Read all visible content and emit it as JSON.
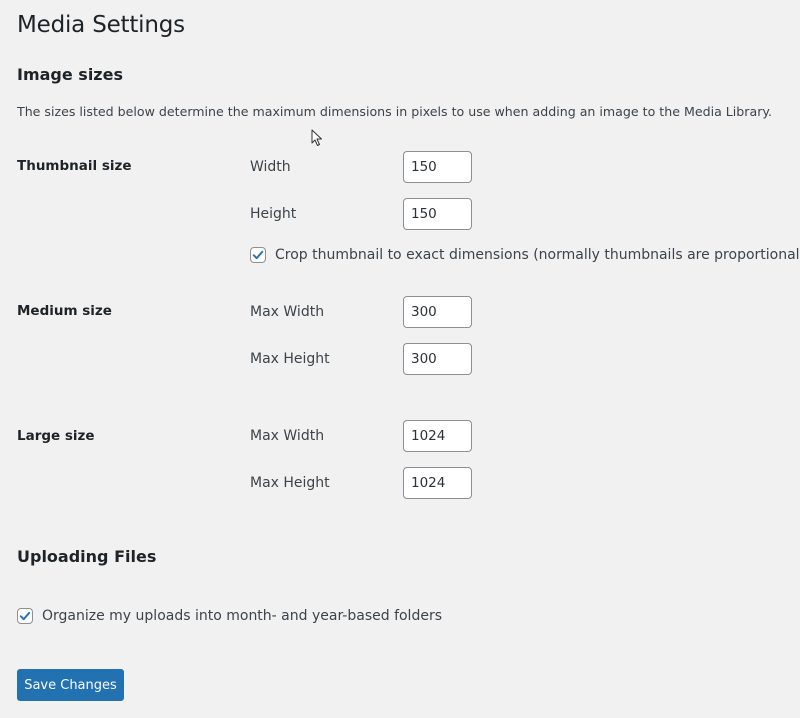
{
  "page": {
    "title": "Media Settings"
  },
  "image_sizes": {
    "heading": "Image sizes",
    "description": "The sizes listed below determine the maximum dimensions in pixels to use when adding an image to the Media Library.",
    "thumbnail": {
      "label": "Thumbnail size",
      "width_label": "Width",
      "width_value": "150",
      "height_label": "Height",
      "height_value": "150",
      "crop_checked": true,
      "crop_label": "Crop thumbnail to exact dimensions (normally thumbnails are proportional)"
    },
    "medium": {
      "label": "Medium size",
      "width_label": "Max Width",
      "width_value": "300",
      "height_label": "Max Height",
      "height_value": "300"
    },
    "large": {
      "label": "Large size",
      "width_label": "Max Width",
      "width_value": "1024",
      "height_label": "Max Height",
      "height_value": "1024"
    }
  },
  "uploading": {
    "heading": "Uploading Files",
    "organize_checked": true,
    "organize_label": "Organize my uploads into month- and year-based folders"
  },
  "actions": {
    "save_label": "Save Changes"
  },
  "colors": {
    "accent": "#2271b1",
    "background": "#f1f1f1"
  },
  "icons": {
    "checkmark": "checkmark-icon",
    "cursor": "mouse-pointer-icon"
  }
}
